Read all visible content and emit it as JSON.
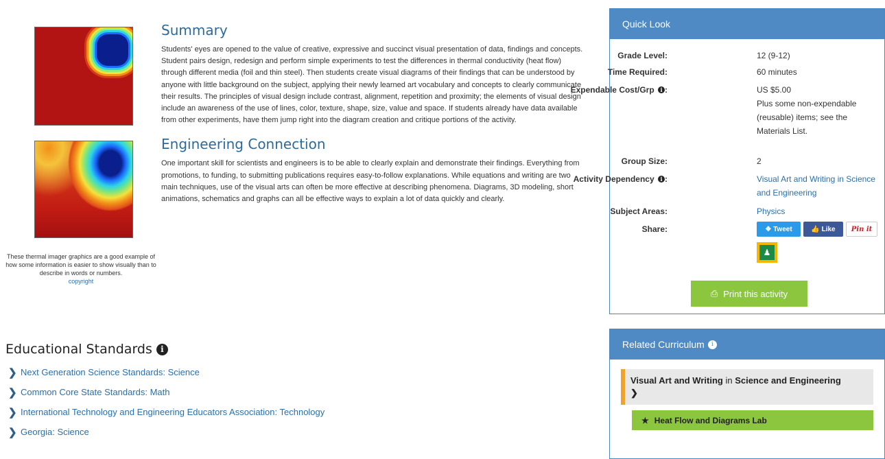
{
  "figure": {
    "caption": "These thermal imager graphics are a good example of how some information is easier to show visually than to describe in words or numbers.",
    "copyright_link": "copyright"
  },
  "summary": {
    "heading": "Summary",
    "text": "Students' eyes are opened to the value of creative, expressive and succinct visual presentation of data, findings and concepts. Student pairs design, redesign and perform simple experiments to test the differences in thermal conductivity (heat flow) through different media (foil and thin steel). Then students create visual diagrams of their findings that can be understood by anyone with little background on the subject, applying their newly learned art vocabulary and concepts to clearly communicate their results. The principles of visual design include contrast, alignment, repetition and proximity; the elements of visual design include an awareness of the use of lines, color, texture, shape, size, value and space. If students already have data available from other experiments, have them jump right into the diagram creation and critique portions of the activity."
  },
  "engineering": {
    "heading": "Engineering Connection",
    "text": "One important skill for scientists and engineers is to be able to clearly explain and demonstrate their findings. Everything from promotions, to funding, to submitting publications requires easy-to-follow explanations. While equations and writing are two main techniques, use of the visual arts can often be more effective at describing phenomena. Diagrams, 3D modeling, short animations, schematics and graphs can all be effective ways to explain a lot of data quickly and clearly."
  },
  "standards": {
    "heading": "Educational Standards",
    "items": [
      "Next Generation Science Standards: Science",
      "Common Core State Standards: Math",
      "International Technology and Engineering Educators Association: Technology",
      "Georgia: Science"
    ]
  },
  "quick_look": {
    "heading": "Quick Look",
    "grade_label": "Grade Level:",
    "grade_value": "12 (9-12)",
    "time_label": "Time Required:",
    "time_value": "60 minutes",
    "cost_label": "Expendable Cost/Grp",
    "cost_value": "US $5.00",
    "cost_note": "Plus some non-expendable (reusable) items; see the Materials List.",
    "group_label": "Group Size:",
    "group_value": "2",
    "dependency_label": "Activity Dependency",
    "dependency_value": "Visual Art and Writing in Science and Engineering",
    "subject_label": "Subject Areas:",
    "subject_value": "Physics",
    "share_label": "Share:",
    "tweet_label": "Tweet",
    "like_label": "Like",
    "pin_label": "Pin it",
    "print_label": "Print this activity"
  },
  "related": {
    "heading": "Related Curriculum",
    "parent_bold1": "Visual Art and Writing",
    "parent_normal": " in ",
    "parent_bold2": "Science and Engineering",
    "child": "Heat Flow and Diagrams Lab"
  },
  "colors": {
    "panel_header": "#4f8ac4",
    "link": "#2a6fad",
    "heading": "#2d6a99",
    "print_button": "#8cc63f",
    "related_accent": "#f0a32a"
  }
}
